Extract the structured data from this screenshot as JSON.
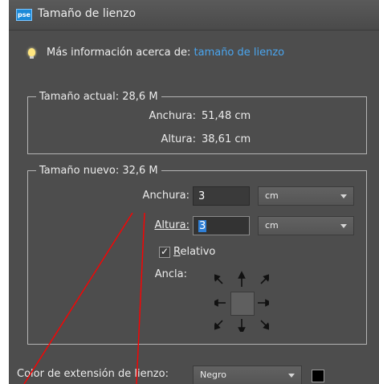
{
  "window": {
    "app_icon": "pse",
    "title": "Tamaño de lienzo"
  },
  "info": {
    "prefix": "Más información acerca de:",
    "link": "tamaño de lienzo",
    "icon": "lightbulb-icon"
  },
  "current_size": {
    "legend": "Tamaño actual: 28,6 M",
    "width_label": "Anchura:",
    "width_value": "51,48 cm",
    "height_label": "Altura:",
    "height_value": "38,61 cm"
  },
  "new_size": {
    "legend": "Tamaño nuevo: 32,6 M",
    "width_label": "Anchura:",
    "width_value": "3",
    "width_unit": "cm",
    "height_label": "Altura:",
    "height_value": "3",
    "height_unit": "cm",
    "relative_label": "Relativo",
    "relative_checked": true,
    "anchor_label": "Ancla:"
  },
  "extension": {
    "label": "Color de extensión de lienzo:",
    "value": "Negro",
    "swatch_color": "#000000"
  },
  "colors": {
    "dialog_bg": "#4d4d4d",
    "link": "#4aa6f0",
    "annotation": "#ff0000",
    "selection": "#2f7fd6"
  }
}
